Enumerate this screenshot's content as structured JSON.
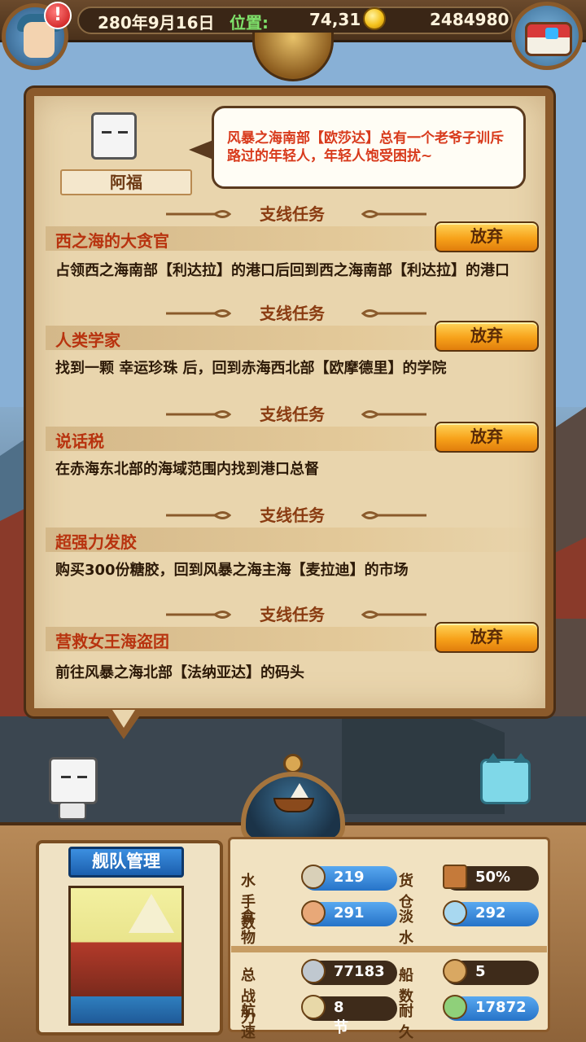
{
  "topbar": {
    "date": "280年9月16日",
    "position_label": "位置:",
    "position_value": "74,31",
    "gold": "2484980"
  },
  "npc": {
    "name": "阿福",
    "speech": "风暴之海南部【欧莎达】总有一个老爷子训斥路过的年轻人，年轻人饱受困扰~"
  },
  "quests": [
    {
      "category": "支线任务",
      "title": "西之海的大贪官",
      "desc": "占领西之海南部【利达拉】的港口后回到西之海南部【利达拉】的港口",
      "abandon": "放弃"
    },
    {
      "category": "支线任务",
      "title": "人类学家",
      "desc": "找到一颗 幸运珍珠 后，回到赤海西北部【欧摩德里】的学院",
      "abandon": "放弃"
    },
    {
      "category": "支线任务",
      "title": "说话税",
      "desc": "在赤海东北部的海域范围内找到港口总督",
      "abandon": "放弃"
    },
    {
      "category": "支线任务",
      "title": "超强力发胶",
      "desc": "购买300份糖胶，回到风暴之海主海【麦拉迪】的市场"
    },
    {
      "category": "支线任务",
      "title": "营救女王海盗团",
      "desc": "前往风暴之海北部【法纳亚达】的码头",
      "abandon": "放弃"
    }
  ],
  "fleet": {
    "title": "舰队管理",
    "stats": {
      "sailors": {
        "label": "水手数",
        "value": "219"
      },
      "cargo": {
        "label": "货仓",
        "value": "50%"
      },
      "food": {
        "label": "食物",
        "value": "291"
      },
      "water": {
        "label": "淡水",
        "value": "292"
      },
      "power": {
        "label": "总战力",
        "value": "77183"
      },
      "ships": {
        "label": "船数",
        "value": "5"
      },
      "speed": {
        "label": "航速",
        "value": "8节"
      },
      "durability": {
        "label": "耐久",
        "value": "17872"
      }
    }
  },
  "colors": {
    "parchment": "#e9d5ad",
    "frame": "#8b5a2b",
    "quest_title": "#b8330f",
    "speech_text": "#d83a1c",
    "button": "#f7a21a",
    "stat_blue": "#2673c8"
  }
}
